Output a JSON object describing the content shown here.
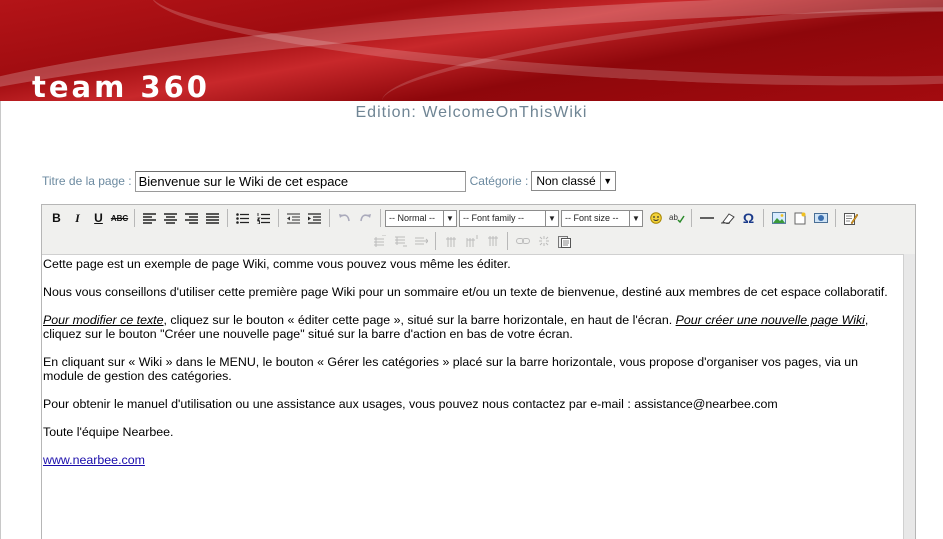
{
  "header": {
    "brand": "team 360",
    "edition_title": "Edition: WelcomeOnThisWiki"
  },
  "form": {
    "title_label": "Titre de la page :",
    "title_value": "Bienvenue sur le Wiki de cet espace",
    "category_label": "Catégorie :",
    "category_value": "Non classé"
  },
  "toolbar": {
    "format_select": "-- Normal --",
    "font_family_select": "-- Font family --",
    "font_size_select": "-- Font size --",
    "bold": "B",
    "italic": "I",
    "underline": "U",
    "strike": "ABC",
    "omega": "Ω"
  },
  "content": {
    "p1": "Cette page est un exemple de page Wiki, comme vous pouvez vous même les éditer.",
    "p2": "Nous vous conseillons d'utiliser cette première page Wiki pour un sommaire et/ou un texte de bienvenue, destiné aux membres de cet espace collaboratif.",
    "p3_link1": "Pour modifier ce texte",
    "p3_mid": ", cliquez sur le bouton « éditer cette page », situé sur la barre horizontale, en haut de l'écran. ",
    "p3_link2": "Pour créer une nouvelle page Wiki",
    "p3_end": ", cliquez sur le bouton \"Créer une nouvelle page\" situé sur la barre d'action en bas de votre écran.",
    "p4": "En cliquant sur « Wiki » dans le MENU, le bouton « Gérer les catégories » placé sur la barre horizontale, vous propose d'organiser vos pages, via un module de gestion des catégories.",
    "p5": "Pour obtenir le manuel d'utilisation ou une assistance aux usages, vous pouvez nous contactez par e-mail : assistance@nearbee.com",
    "p6": "Toute l'équipe Nearbee.",
    "link": "www.nearbee.com"
  },
  "colors": {
    "banner": "#a00c10",
    "label": "#6c8aa0",
    "link": "#1a0dab"
  }
}
